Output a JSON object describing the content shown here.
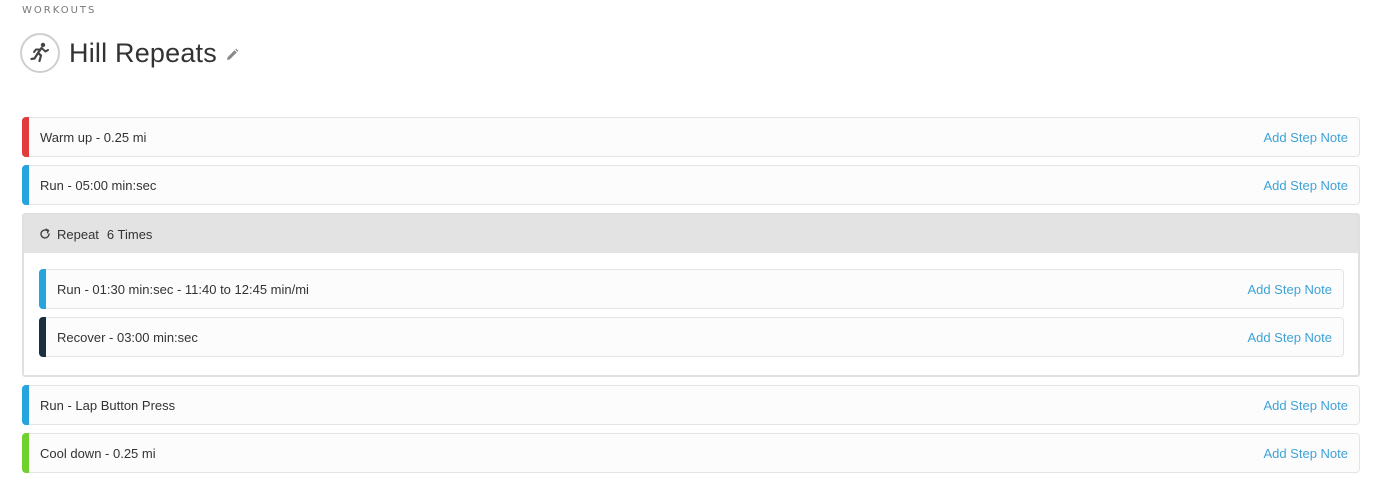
{
  "header": {
    "eyebrow": "WORKOUTS",
    "title": "Hill Repeats",
    "icon": "runner-icon",
    "edit_icon": "pencil-icon"
  },
  "steps_before": [
    {
      "label": "Warm up - 0.25 mi",
      "color": "#e23b3b",
      "note_label": "Add Step Note"
    },
    {
      "label": "Run - 05:00 min:sec",
      "color": "#25a4de",
      "note_label": "Add Step Note"
    }
  ],
  "repeat": {
    "icon": "repeat-icon",
    "label": "Repeat",
    "times": "6 Times",
    "steps": [
      {
        "label": "Run - 01:30 min:sec - 11:40 to 12:45 min/mi",
        "color": "#25a4de",
        "note_label": "Add Step Note"
      },
      {
        "label": "Recover - 03:00 min:sec",
        "color": "#18303f",
        "note_label": "Add Step Note"
      }
    ]
  },
  "steps_after": [
    {
      "label": "Run - Lap Button Press",
      "color": "#25a4de",
      "note_label": "Add Step Note"
    },
    {
      "label": "Cool down - 0.25 mi",
      "color": "#6fd12b",
      "note_label": "Add Step Note"
    }
  ]
}
